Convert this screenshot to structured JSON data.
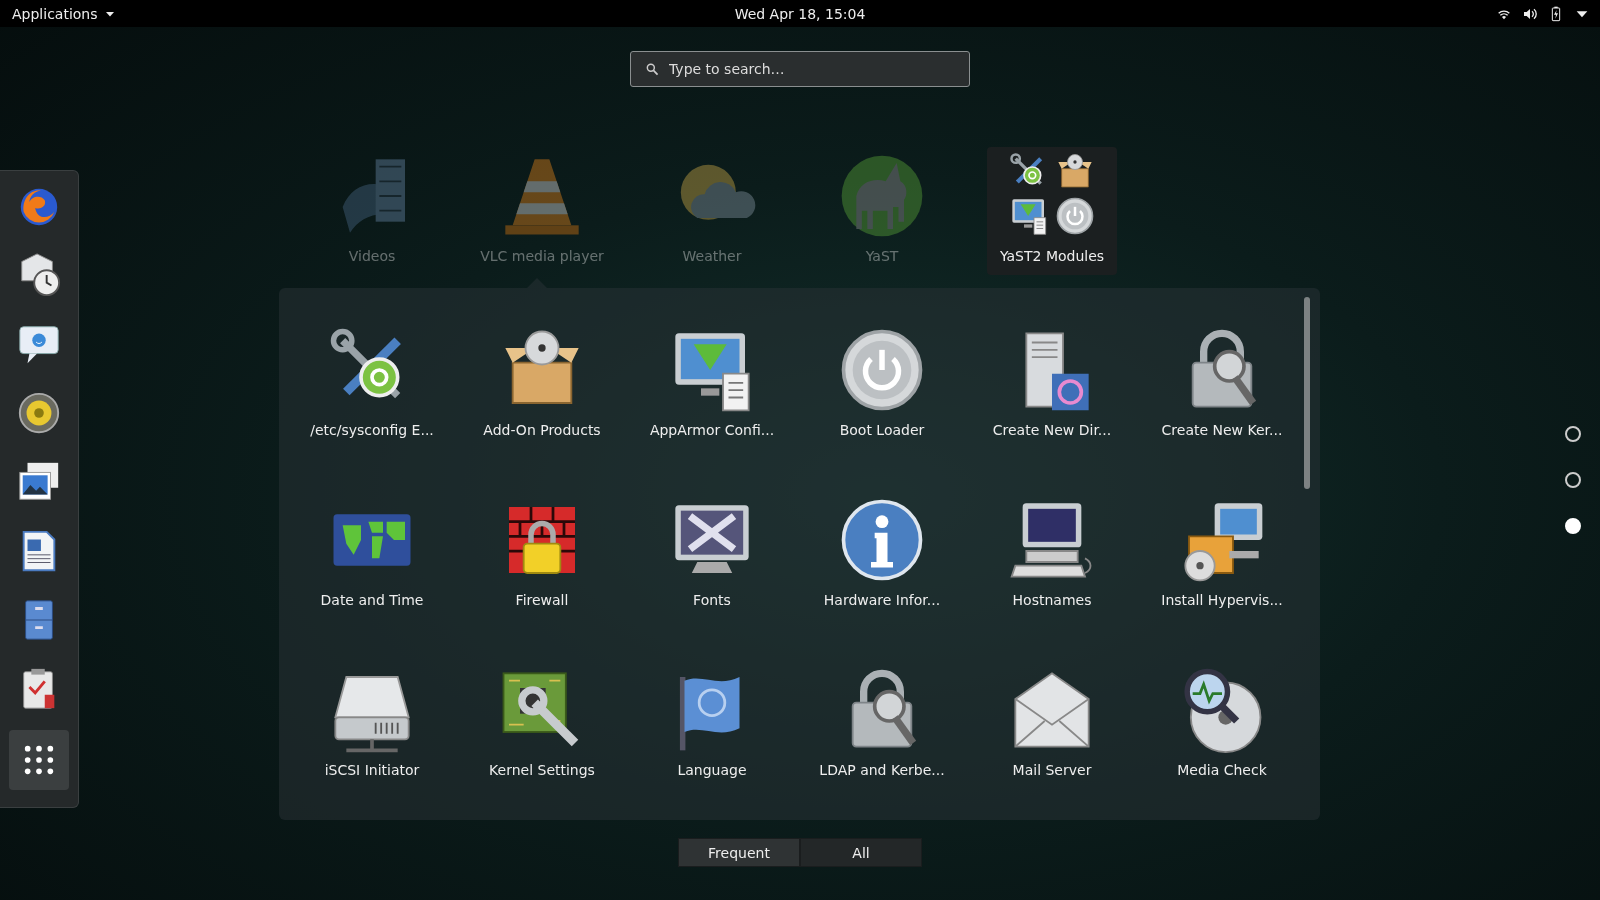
{
  "top_bar": {
    "applications_menu": "Applications",
    "clock": "Wed Apr 18, 15:04"
  },
  "search": {
    "placeholder": "Type to search…"
  },
  "frequent_row": [
    {
      "label": "Videos",
      "kind": "app"
    },
    {
      "label": "VLC media player",
      "kind": "app"
    },
    {
      "label": "Weather",
      "kind": "app"
    },
    {
      "label": "YaST",
      "kind": "app"
    },
    {
      "label": "YaST2 Modules",
      "kind": "folder",
      "expanded": true
    }
  ],
  "folder_apps": [
    {
      "label": "/etc/sysconfig E..."
    },
    {
      "label": "Add-On Products"
    },
    {
      "label": "AppArmor Confi..."
    },
    {
      "label": "Boot Loader"
    },
    {
      "label": "Create New Dir..."
    },
    {
      "label": "Create New Ker..."
    },
    {
      "label": "Date and Time"
    },
    {
      "label": "Firewall"
    },
    {
      "label": "Fonts"
    },
    {
      "label": "Hardware Infor..."
    },
    {
      "label": "Hostnames"
    },
    {
      "label": "Install Hypervis..."
    },
    {
      "label": "iSCSI Initiator"
    },
    {
      "label": "Kernel Settings"
    },
    {
      "label": "Language"
    },
    {
      "label": "LDAP and Kerbe..."
    },
    {
      "label": "Mail Server"
    },
    {
      "label": "Media Check"
    }
  ],
  "pages": [
    {
      "selected": false
    },
    {
      "selected": false
    },
    {
      "selected": true
    }
  ],
  "view_switcher": [
    {
      "label": "Frequent",
      "selected": false
    },
    {
      "label": "All",
      "selected": true
    }
  ]
}
